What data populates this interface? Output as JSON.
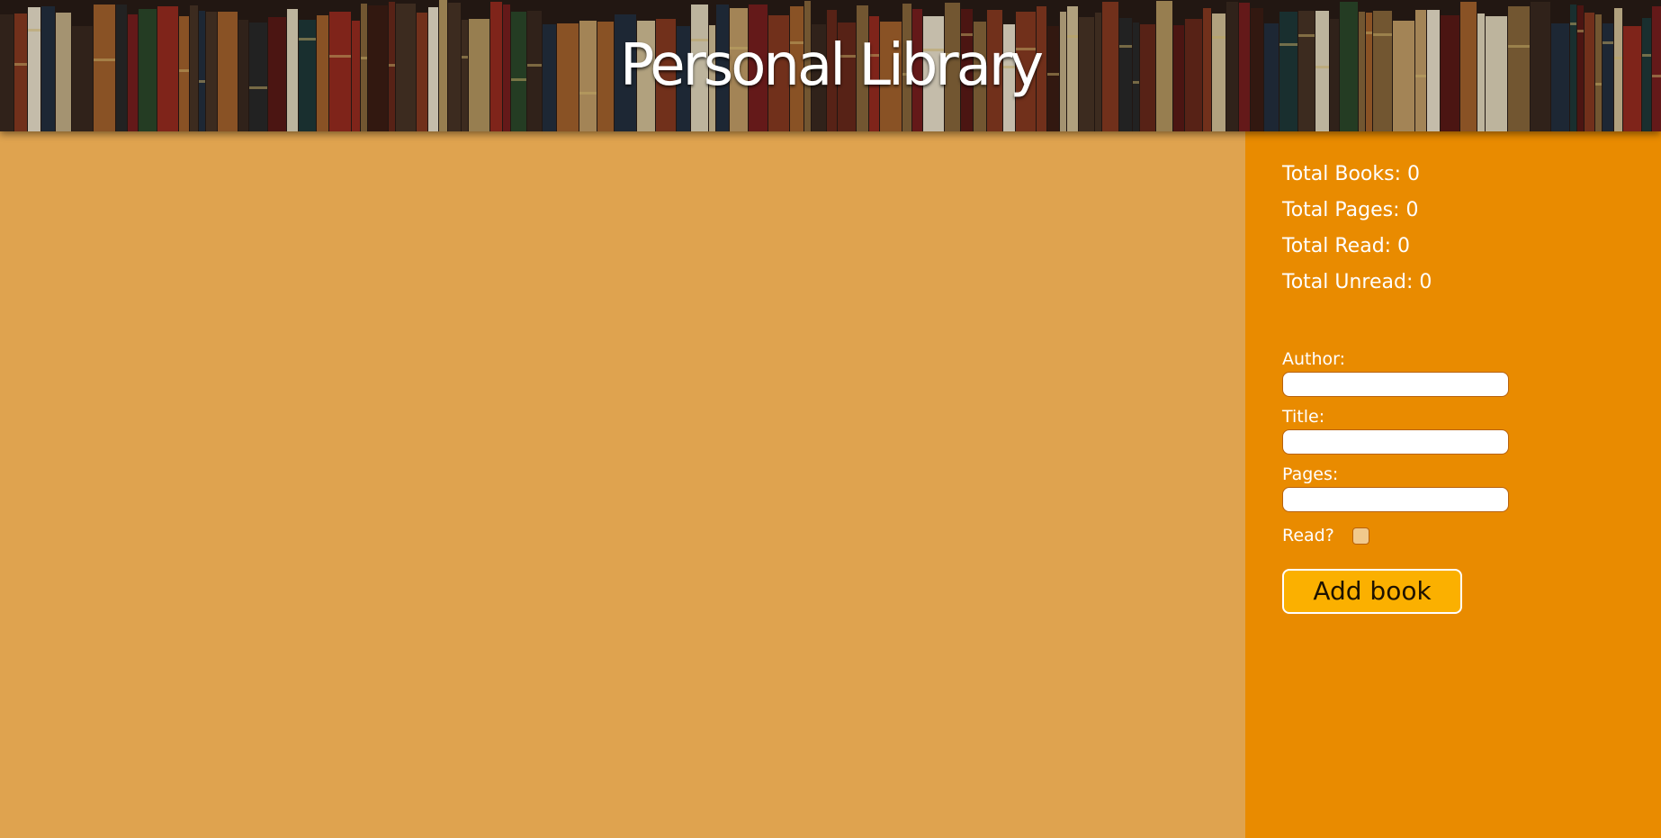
{
  "header": {
    "title": "Personal Library",
    "background_image": "bookshelf"
  },
  "stats": {
    "total_books": "Total Books: 0",
    "total_pages": "Total Pages: 0",
    "total_read": "Total Read: 0",
    "total_unread": "Total Unread: 0"
  },
  "form": {
    "author_label": "Author:",
    "author_value": "",
    "title_label": "Title:",
    "title_value": "",
    "pages_label": "Pages:",
    "pages_value": "",
    "read_label": "Read?",
    "read_checked": false,
    "add_button_label": "Add book"
  },
  "colors": {
    "main_bg": "#dfa34f",
    "sidebar_bg": "#e98b00",
    "button_bg": "#fbb000",
    "text": "#ffffff"
  }
}
